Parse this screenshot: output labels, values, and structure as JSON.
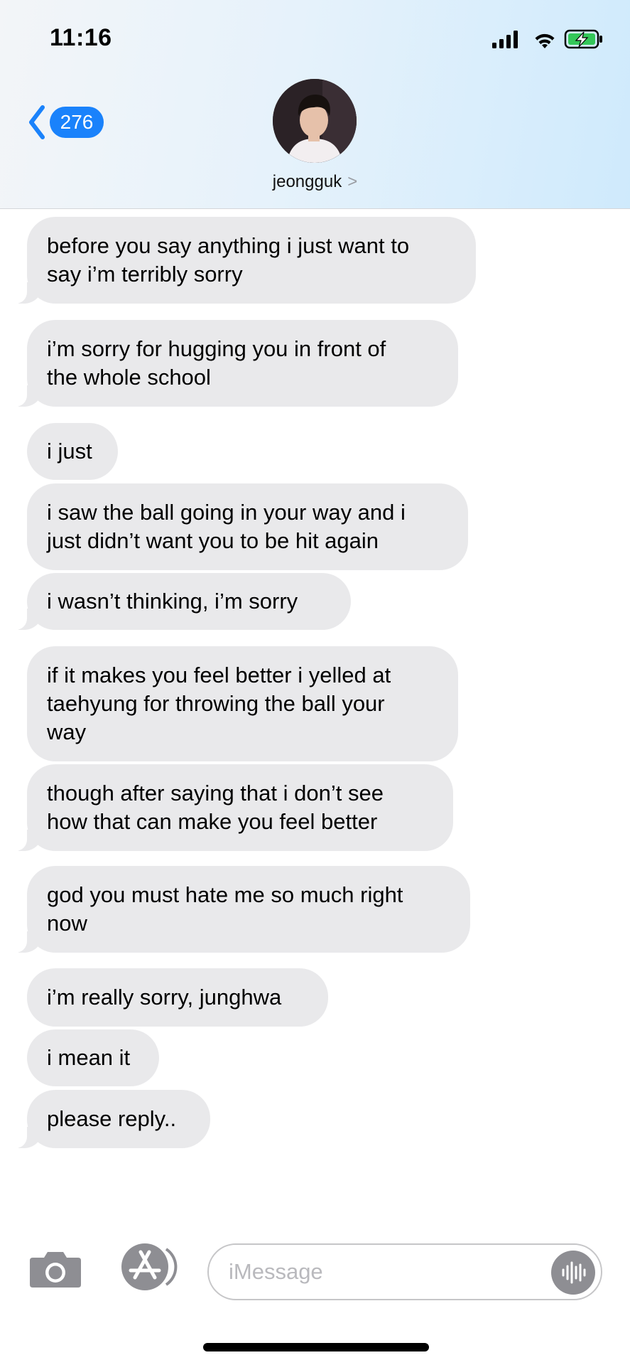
{
  "status_bar": {
    "time": "11:16"
  },
  "nav": {
    "back_count": "276",
    "contact_name": "jeongguk",
    "contact_chevron": ">"
  },
  "messages": [
    "before you say anything i just want to say i’m terribly sorry",
    "i’m sorry for hugging you in front of the whole school",
    "i just",
    "i saw the ball going in your way and i just didn’t want you to be hit again",
    "i wasn’t thinking, i’m sorry",
    "if it makes you feel better i yelled at taehyung for throwing the ball your way",
    "though after saying that i don’t see how that can make you feel better",
    "god you must hate me so much right now",
    "i’m really sorry, junghwa",
    "i mean it",
    "please reply.."
  ],
  "message_lines": [
    [
      "before you say anything i just want to",
      "say i’m terribly sorry"
    ],
    [
      "i’m sorry for hugging you in front of",
      "the whole school"
    ],
    [
      "i just"
    ],
    [
      "i saw the ball going in your way and i",
      "just didn’t want you to be hit again"
    ],
    [
      "i wasn’t thinking, i’m sorry"
    ],
    [
      "if it makes you feel better i yelled at",
      "taehyung for throwing the ball your",
      "way"
    ],
    [
      "though after saying that i don’t see",
      "how that can make you feel better"
    ],
    [
      "god you must hate me so much right",
      "now"
    ],
    [
      "i’m really sorry, junghwa"
    ],
    [
      "i mean it"
    ],
    [
      "please reply.."
    ]
  ],
  "input": {
    "placeholder": "iMessage"
  },
  "colors": {
    "accent": "#1a82fb",
    "battery_fill": "#34c759",
    "bubble_incoming": "#e9e9eb",
    "header_gradient_end": "#cfeafc"
  },
  "icons": [
    "cellular-signal-icon",
    "wifi-icon",
    "battery-charging-icon",
    "chevron-left-icon",
    "camera-icon",
    "app-store-icon",
    "audio-waveform-icon"
  ]
}
